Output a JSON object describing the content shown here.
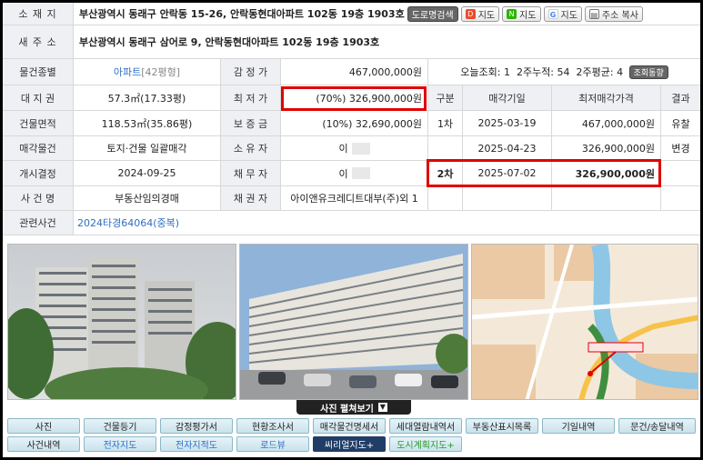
{
  "address": {
    "label": "소 재 지",
    "value": "부산광역시 동래구 안락동 15-26, 안락동현대아파트 102동 19층 1903호",
    "buttons": [
      "도로명검색",
      "지도",
      "지도",
      "지도",
      "주소 복사"
    ]
  },
  "new_address": {
    "label": "새 주 소",
    "value": "부산광역시 동래구 삼어로 9, 안락동현대아파트 102동 19층 1903호"
  },
  "info": {
    "type_label": "물건종별",
    "type_value": "아파트",
    "type_size": "[42평형]",
    "appraisal_label": "감 정 가",
    "appraisal_value": "467,000,000원",
    "land_label": "대 지 권",
    "land_value": "57.3㎡(17.33평)",
    "minprice_label": "최 저 가",
    "minprice_value": "(70%) 326,900,000원",
    "building_label": "건물면적",
    "building_value": "118.53㎡(35.86평)",
    "deposit_label": "보 증 금",
    "deposit_value": "(10%) 32,690,000원",
    "sale_label": "매각물건",
    "sale_value": "토지·건물 일괄매각",
    "owner_label": "소 유 자",
    "owner_value": "이",
    "start_label": "개시결정",
    "start_value": "2024-09-25",
    "debtor_label": "채 무 자",
    "debtor_value": "이",
    "case_label": "사 건 명",
    "case_value": "부동산임의경매",
    "creditor_label": "채 권 자",
    "creditor_value": "아이앤유크레디트대부(주)외 1",
    "related_label": "관련사건",
    "related_value": "2024타경64064(중복)"
  },
  "views": {
    "today_label": "오늘조회:",
    "today": "1",
    "twoweek_label": "2주누적:",
    "twoweek": "54",
    "avg_label": "2주평균:",
    "avg": "4",
    "trend_button": "조회동향"
  },
  "auction_table": {
    "headers": [
      "구분",
      "매각기일",
      "최저매각가격",
      "결과"
    ],
    "rows": [
      {
        "round": "1차",
        "date": "2025-03-19",
        "price": "467,000,000원",
        "result": "유찰"
      },
      {
        "round": "",
        "date": "2025-04-23",
        "price": "326,900,000원",
        "result": "변경"
      },
      {
        "round": "2차",
        "date": "2025-07-02",
        "price": "326,900,000원",
        "result": ""
      }
    ]
  },
  "expand_label": "사진 펼쳐보기",
  "tabs_row1": [
    "사진",
    "건물등기",
    "감정평가서",
    "현황조사서",
    "매각물건명세서",
    "세대열람내역서",
    "부동산표시목록",
    "기일내역",
    "문건/송달내역"
  ],
  "tabs_row2": [
    "사건내역",
    "전자지도",
    "전자지적도",
    "로드뷰",
    "씨리얼지도+",
    "도시계획지도+"
  ],
  "colors": {
    "highlight": "#e00000",
    "link": "#2f6fc4",
    "selected_tab": "#1f3d66"
  }
}
